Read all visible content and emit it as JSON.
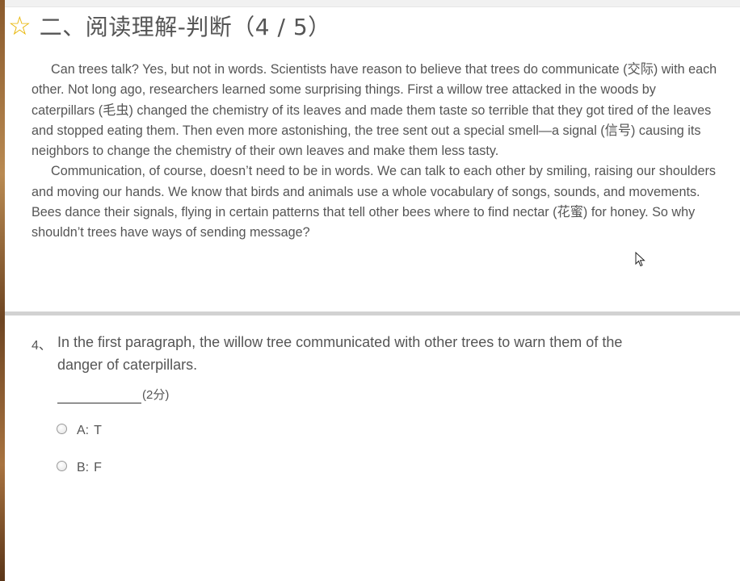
{
  "header": {
    "icon": "star-outline-icon",
    "title": "二、阅读理解-判断（4 / 5）"
  },
  "passage": {
    "paragraphs": [
      "Can trees talk? Yes, but not in words. Scientists have reason to believe that trees do communicate (交际) with each other. Not long ago, researchers learned some surprising things. First a willow tree attacked in the woods by caterpillars (毛虫) changed the chemistry of its leaves and made them taste so terrible that they got tired of the leaves and stopped eating them. Then even more astonishing, the tree sent out a special smell—a signal (信号) causing its neighbors to change the chemistry of their own leaves and make them less tasty.",
      "Communication, of course, doesn’t need to be in words. We can talk to each other by smiling, raising our shoulders and moving our hands. We know that birds and animals use a whole vocabulary of songs, sounds, and movements. Bees dance their signals, flying in certain patterns that tell other bees where to find nectar (花蜜) for honey. So why shouldn’t trees have ways of sending message?"
    ]
  },
  "question": {
    "number": "4、",
    "text": "In the first paragraph, the willow tree communicated with other trees to warn them of the danger of caterpillars.",
    "score": "(2分)",
    "options": [
      {
        "letter": "A:",
        "value": "T"
      },
      {
        "letter": "B:",
        "value": "F"
      }
    ]
  },
  "colors": {
    "star": "#e8b400",
    "text": "#555555",
    "divider": "#d2d2d2"
  }
}
